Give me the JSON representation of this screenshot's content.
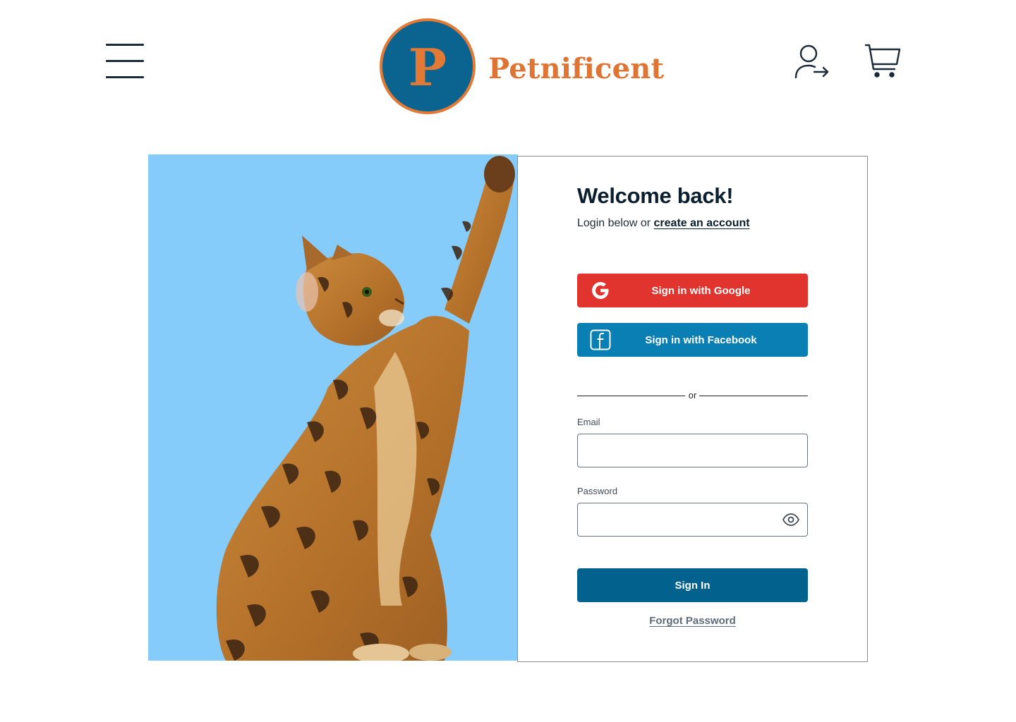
{
  "header": {
    "brand_letter": "P",
    "brand_name": "Petnificent",
    "menu_icon": "hamburger-menu-icon",
    "user_icon": "user-login-icon",
    "cart_icon": "shopping-cart-icon"
  },
  "login": {
    "title": "Welcome back!",
    "subtitle_prefix": "Login below or ",
    "create_account_link": "create an account",
    "google_button": "Sign in with Google",
    "facebook_button": "Sign in with Facebook",
    "divider_text": "or",
    "email_label": "Email",
    "email_value": "",
    "password_label": "Password",
    "password_value": "",
    "password_toggle_icon": "eye-icon",
    "signin_button": "Sign In",
    "forgot_password_link": "Forgot Password"
  },
  "colors": {
    "brand_blue": "#0b6390",
    "brand_orange": "#e27a36",
    "google_red": "#e2342e",
    "facebook_blue": "#0a7fb4",
    "signin_blue": "#03628d",
    "photo_background": "#85ccfb"
  }
}
